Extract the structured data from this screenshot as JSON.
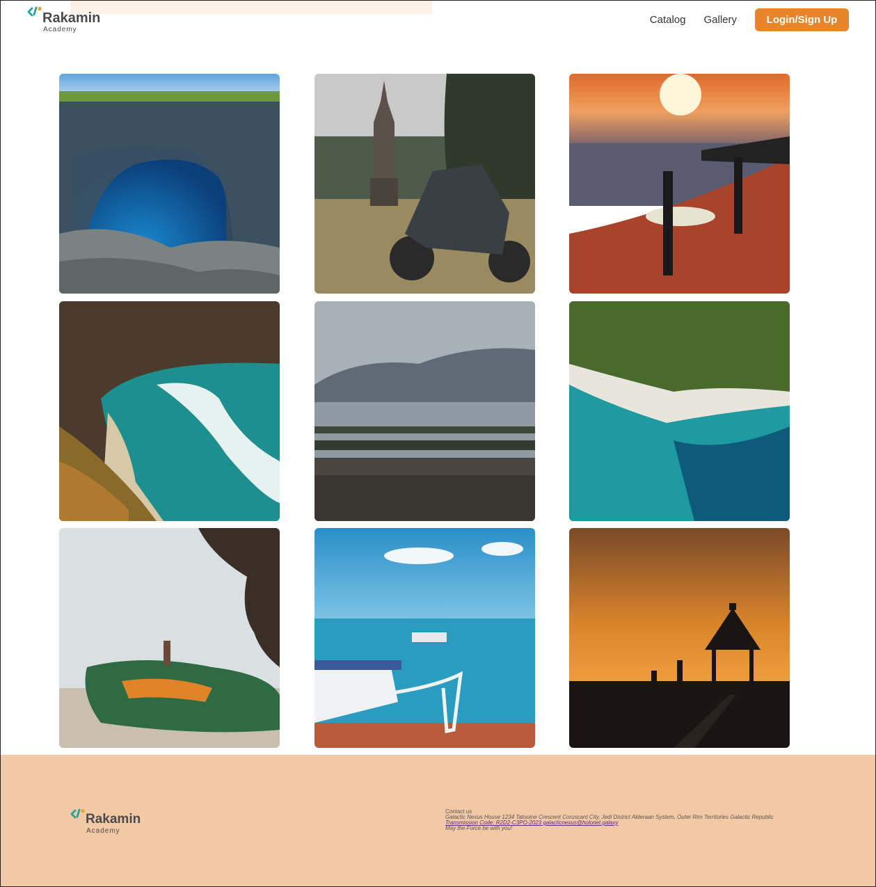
{
  "header": {
    "brand": {
      "name": "Rakamin",
      "tagline": "Academy"
    },
    "nav": {
      "catalog": "Catalog",
      "gallery": "Gallery",
      "login": "Login/Sign Up"
    }
  },
  "colors": {
    "accent": "#e8842a",
    "footer_bg": "#f3c9a5",
    "brand_teal": "#1fa39a",
    "brand_orange": "#f0a020"
  },
  "gallery": {
    "photos": [
      "sea-arch-cliff-photo",
      "motorcycle-temple-photo",
      "sunset-surfer-beach-photo",
      "cliff-bay-waves-photo",
      "misty-mountain-shore-photo",
      "aerial-coastline-photo",
      "graffiti-rock-beach-photo",
      "outrigger-boats-sea-photo",
      "sunset-gazebo-silhouette-photo"
    ]
  },
  "footer": {
    "brand": {
      "name": "Rakamin",
      "tagline": "Academy"
    },
    "contact": {
      "heading": "Contact us",
      "address": "Galactic Nexus House 1234 Tatooine Crescent Coruscant City, Jedi District Alderaan System, Outer Rim Territories Galactic Republic",
      "transmission": "Transmission Code: R2D2-C3PO-2023 galacticnexus@holonet.galaxy",
      "signoff": "May the Force be with you!"
    }
  }
}
